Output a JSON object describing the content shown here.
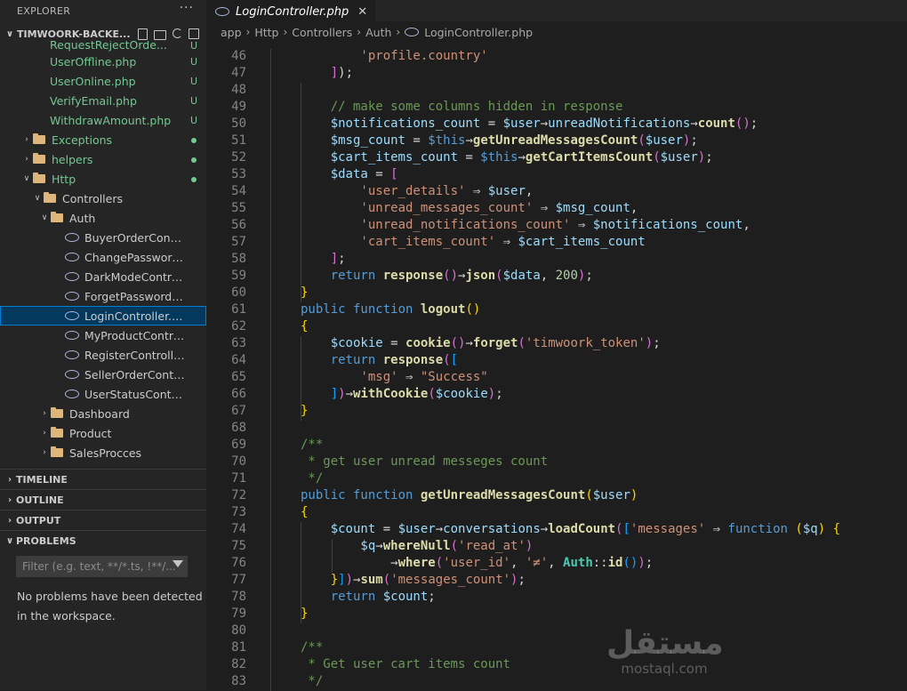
{
  "sidebar": {
    "title": "EXPLORER",
    "more": "···",
    "root": {
      "chevron": "∨",
      "name": "TIMWOORK-BACKE..."
    },
    "tree": [
      {
        "name": "RequestRejectOrde...",
        "type": "file",
        "depth": 3,
        "status": "U",
        "green": true,
        "partial": true
      },
      {
        "name": "UserOffline.php",
        "type": "file",
        "depth": 3,
        "status": "U",
        "green": true
      },
      {
        "name": "UserOnline.php",
        "type": "file",
        "depth": 3,
        "status": "U",
        "green": true
      },
      {
        "name": "VerifyEmail.php",
        "type": "file",
        "depth": 3,
        "status": "U",
        "green": true
      },
      {
        "name": "WithdrawAmount.php",
        "type": "file",
        "depth": 3,
        "status": "U",
        "green": true
      },
      {
        "name": "Exceptions",
        "type": "folder",
        "depth": 1,
        "chevron": "›",
        "dot": true,
        "green": true
      },
      {
        "name": "helpers",
        "type": "folder",
        "depth": 1,
        "chevron": "›",
        "dot": true,
        "green": true
      },
      {
        "name": "Http",
        "type": "folder",
        "depth": 1,
        "chevron": "∨",
        "dot": true,
        "green": true
      },
      {
        "name": "Controllers",
        "type": "folder",
        "depth": 2,
        "chevron": "∨"
      },
      {
        "name": "Auth",
        "type": "folder",
        "depth": 3,
        "chevron": "∨"
      },
      {
        "name": "BuyerOrderController...",
        "type": "php",
        "depth": 4
      },
      {
        "name": "ChangePasswordCont...",
        "type": "php",
        "depth": 4
      },
      {
        "name": "DarkModeController.p...",
        "type": "php",
        "depth": 4
      },
      {
        "name": "ForgetPasswordContr...",
        "type": "php",
        "depth": 4
      },
      {
        "name": "LoginController.php",
        "type": "php",
        "depth": 4,
        "selected": true
      },
      {
        "name": "MyProductController....",
        "type": "php",
        "depth": 4
      },
      {
        "name": "RegisterController.php",
        "type": "php",
        "depth": 4
      },
      {
        "name": "SellerOrderController....",
        "type": "php",
        "depth": 4
      },
      {
        "name": "UserStatusController....",
        "type": "php",
        "depth": 4
      },
      {
        "name": "Dashboard",
        "type": "folder",
        "depth": 3,
        "chevron": "›"
      },
      {
        "name": "Product",
        "type": "folder",
        "depth": 3,
        "chevron": "›"
      },
      {
        "name": "SalesProcces",
        "type": "folder",
        "depth": 3,
        "chevron": "›"
      }
    ],
    "sections": [
      {
        "label": "TIMELINE",
        "chevron": "›"
      },
      {
        "label": "OUTLINE",
        "chevron": "›"
      },
      {
        "label": "OUTPUT",
        "chevron": "›"
      },
      {
        "label": "PROBLEMS",
        "chevron": "∨"
      }
    ],
    "filter_placeholder": "Filter (e.g. text, **/*.ts, !**/...",
    "problems_message": "No problems have been detected in the workspace."
  },
  "editor": {
    "tab": {
      "label": "LoginController.php",
      "close": "✕"
    },
    "breadcrumbs": [
      "app",
      "Http",
      "Controllers",
      "Auth",
      "LoginController.php"
    ],
    "breadcrumb_sep": "›",
    "first_line": 46,
    "lines": [
      [
        [
          "            ",
          ""
        ],
        [
          "'profile.country'",
          "s"
        ]
      ],
      [
        [
          "        ",
          ""
        ],
        [
          "]",
          "b2"
        ],
        [
          ");",
          ""
        ]
      ],
      [
        [
          "",
          ""
        ]
      ],
      [
        [
          "        ",
          ""
        ],
        [
          "// make some columns hidden in response",
          "c"
        ]
      ],
      [
        [
          "        ",
          ""
        ],
        [
          "$notifications_count",
          "v"
        ],
        [
          " = ",
          ""
        ],
        [
          "$user",
          "v"
        ],
        [
          "→",
          "op"
        ],
        [
          "unreadNotifications",
          "v"
        ],
        [
          "→",
          "op"
        ],
        [
          "count",
          "f"
        ],
        [
          "()",
          "b2"
        ],
        [
          ";",
          ""
        ]
      ],
      [
        [
          "        ",
          ""
        ],
        [
          "$msg_count",
          "v"
        ],
        [
          " = ",
          ""
        ],
        [
          "$this",
          "k"
        ],
        [
          "→",
          "op"
        ],
        [
          "getUnreadMessagesCount",
          "f"
        ],
        [
          "(",
          "b2"
        ],
        [
          "$user",
          "v"
        ],
        [
          ")",
          "b2"
        ],
        [
          ";",
          ""
        ]
      ],
      [
        [
          "        ",
          ""
        ],
        [
          "$cart_items_count",
          "v"
        ],
        [
          " = ",
          ""
        ],
        [
          "$this",
          "k"
        ],
        [
          "→",
          "op"
        ],
        [
          "getCartItemsCount",
          "f"
        ],
        [
          "(",
          "b2"
        ],
        [
          "$user",
          "v"
        ],
        [
          ")",
          "b2"
        ],
        [
          ";",
          ""
        ]
      ],
      [
        [
          "        ",
          ""
        ],
        [
          "$data",
          "v"
        ],
        [
          " = ",
          ""
        ],
        [
          "[",
          "b2"
        ]
      ],
      [
        [
          "            ",
          ""
        ],
        [
          "'user_details'",
          "s"
        ],
        [
          " ⇒ ",
          ""
        ],
        [
          "$user",
          "v"
        ],
        [
          ",",
          ""
        ]
      ],
      [
        [
          "            ",
          ""
        ],
        [
          "'unread_messages_count'",
          "s"
        ],
        [
          " ⇒ ",
          ""
        ],
        [
          "$msg_count",
          "v"
        ],
        [
          ",",
          ""
        ]
      ],
      [
        [
          "            ",
          ""
        ],
        [
          "'unread_notifications_count'",
          "s"
        ],
        [
          " ⇒ ",
          ""
        ],
        [
          "$notifications_count",
          "v"
        ],
        [
          ",",
          ""
        ]
      ],
      [
        [
          "            ",
          ""
        ],
        [
          "'cart_items_count'",
          "s"
        ],
        [
          " ⇒ ",
          ""
        ],
        [
          "$cart_items_count",
          "v"
        ]
      ],
      [
        [
          "        ",
          ""
        ],
        [
          "]",
          "b2"
        ],
        [
          ";",
          ""
        ]
      ],
      [
        [
          "        ",
          ""
        ],
        [
          "return",
          "k"
        ],
        [
          " ",
          ""
        ],
        [
          "response",
          "f"
        ],
        [
          "()",
          "b2"
        ],
        [
          "→",
          "op"
        ],
        [
          "json",
          "f"
        ],
        [
          "(",
          "b2"
        ],
        [
          "$data",
          "v"
        ],
        [
          ", ",
          ""
        ],
        [
          "200",
          "n"
        ],
        [
          ")",
          "b2"
        ],
        [
          ";",
          ""
        ]
      ],
      [
        [
          "    ",
          ""
        ],
        [
          "}",
          "b1"
        ]
      ],
      [
        [
          "    ",
          ""
        ],
        [
          "public",
          "k"
        ],
        [
          " ",
          ""
        ],
        [
          "function",
          "k"
        ],
        [
          " ",
          ""
        ],
        [
          "logout",
          "f"
        ],
        [
          "()",
          "b1"
        ]
      ],
      [
        [
          "    ",
          ""
        ],
        [
          "{",
          "b1"
        ]
      ],
      [
        [
          "        ",
          ""
        ],
        [
          "$cookie",
          "v"
        ],
        [
          " = ",
          ""
        ],
        [
          "cookie",
          "f"
        ],
        [
          "()",
          "b2"
        ],
        [
          "→",
          "op"
        ],
        [
          "forget",
          "f"
        ],
        [
          "(",
          "b2"
        ],
        [
          "'timwoork_token'",
          "s"
        ],
        [
          ")",
          "b2"
        ],
        [
          ";",
          ""
        ]
      ],
      [
        [
          "        ",
          ""
        ],
        [
          "return",
          "k"
        ],
        [
          " ",
          ""
        ],
        [
          "response",
          "f"
        ],
        [
          "(",
          "b2"
        ],
        [
          "[",
          "b3"
        ]
      ],
      [
        [
          "            ",
          ""
        ],
        [
          "'msg'",
          "s"
        ],
        [
          " ⇒ ",
          ""
        ],
        [
          "\"Success\"",
          "s"
        ]
      ],
      [
        [
          "        ",
          ""
        ],
        [
          "]",
          "b3"
        ],
        [
          ")",
          "b2"
        ],
        [
          "→",
          "op"
        ],
        [
          "withCookie",
          "f"
        ],
        [
          "(",
          "b2"
        ],
        [
          "$cookie",
          "v"
        ],
        [
          ")",
          "b2"
        ],
        [
          ";",
          ""
        ]
      ],
      [
        [
          "    ",
          ""
        ],
        [
          "}",
          "b1"
        ]
      ],
      [
        [
          "",
          ""
        ]
      ],
      [
        [
          "    ",
          ""
        ],
        [
          "/**",
          "c"
        ]
      ],
      [
        [
          "    ",
          ""
        ],
        [
          " * get user unread messeges count",
          "c"
        ]
      ],
      [
        [
          "    ",
          ""
        ],
        [
          " */",
          "c"
        ]
      ],
      [
        [
          "    ",
          ""
        ],
        [
          "public",
          "k"
        ],
        [
          " ",
          ""
        ],
        [
          "function",
          "k"
        ],
        [
          " ",
          ""
        ],
        [
          "getUnreadMessagesCount",
          "f"
        ],
        [
          "(",
          "b1"
        ],
        [
          "$user",
          "v"
        ],
        [
          ")",
          "b1"
        ]
      ],
      [
        [
          "    ",
          ""
        ],
        [
          "{",
          "b1"
        ]
      ],
      [
        [
          "        ",
          ""
        ],
        [
          "$count",
          "v"
        ],
        [
          " = ",
          ""
        ],
        [
          "$user",
          "v"
        ],
        [
          "→",
          "op"
        ],
        [
          "conversations",
          "v"
        ],
        [
          "→",
          "op"
        ],
        [
          "loadCount",
          "f"
        ],
        [
          "(",
          "b2"
        ],
        [
          "[",
          "b3"
        ],
        [
          "'messages'",
          "s"
        ],
        [
          " ⇒ ",
          ""
        ],
        [
          "function",
          "k"
        ],
        [
          " ",
          ""
        ],
        [
          "(",
          "b1"
        ],
        [
          "$q",
          "v"
        ],
        [
          ")",
          "b1"
        ],
        [
          " ",
          ""
        ],
        [
          "{",
          "b1"
        ]
      ],
      [
        [
          "            ",
          ""
        ],
        [
          "$q",
          "v"
        ],
        [
          "→",
          "op"
        ],
        [
          "whereNull",
          "f"
        ],
        [
          "(",
          "b2"
        ],
        [
          "'read_at'",
          "s"
        ],
        [
          ")",
          "b2"
        ]
      ],
      [
        [
          "                ",
          ""
        ],
        [
          "→",
          "op"
        ],
        [
          "where",
          "f"
        ],
        [
          "(",
          "b2"
        ],
        [
          "'user_id'",
          "s"
        ],
        [
          ", ",
          ""
        ],
        [
          "'≠'",
          "s"
        ],
        [
          ", ",
          ""
        ],
        [
          "Auth",
          "t"
        ],
        [
          "::",
          ""
        ],
        [
          "id",
          "f"
        ],
        [
          "()",
          "b3"
        ],
        [
          ")",
          "b2"
        ],
        [
          ";",
          ""
        ]
      ],
      [
        [
          "        ",
          ""
        ],
        [
          "}",
          "b1"
        ],
        [
          "]",
          "b3"
        ],
        [
          ")",
          "b2"
        ],
        [
          "→",
          "op"
        ],
        [
          "sum",
          "f"
        ],
        [
          "(",
          "b2"
        ],
        [
          "'messages_count'",
          "s"
        ],
        [
          ")",
          "b2"
        ],
        [
          ";",
          ""
        ]
      ],
      [
        [
          "        ",
          ""
        ],
        [
          "return",
          "k"
        ],
        [
          " ",
          ""
        ],
        [
          "$count",
          "v"
        ],
        [
          ";",
          ""
        ]
      ],
      [
        [
          "    ",
          ""
        ],
        [
          "}",
          "b1"
        ]
      ],
      [
        [
          "",
          ""
        ]
      ],
      [
        [
          "    ",
          ""
        ],
        [
          "/**",
          "c"
        ]
      ],
      [
        [
          "    ",
          ""
        ],
        [
          " * Get user cart items count",
          "c"
        ]
      ],
      [
        [
          "    ",
          ""
        ],
        [
          " */",
          "c"
        ]
      ]
    ]
  },
  "watermark": {
    "arabic": "مستقل",
    "latin": "mostaql.com"
  },
  "colors": {
    "accent": "#007fd4",
    "git_untracked": "#73c991",
    "selection": "#04395e"
  }
}
